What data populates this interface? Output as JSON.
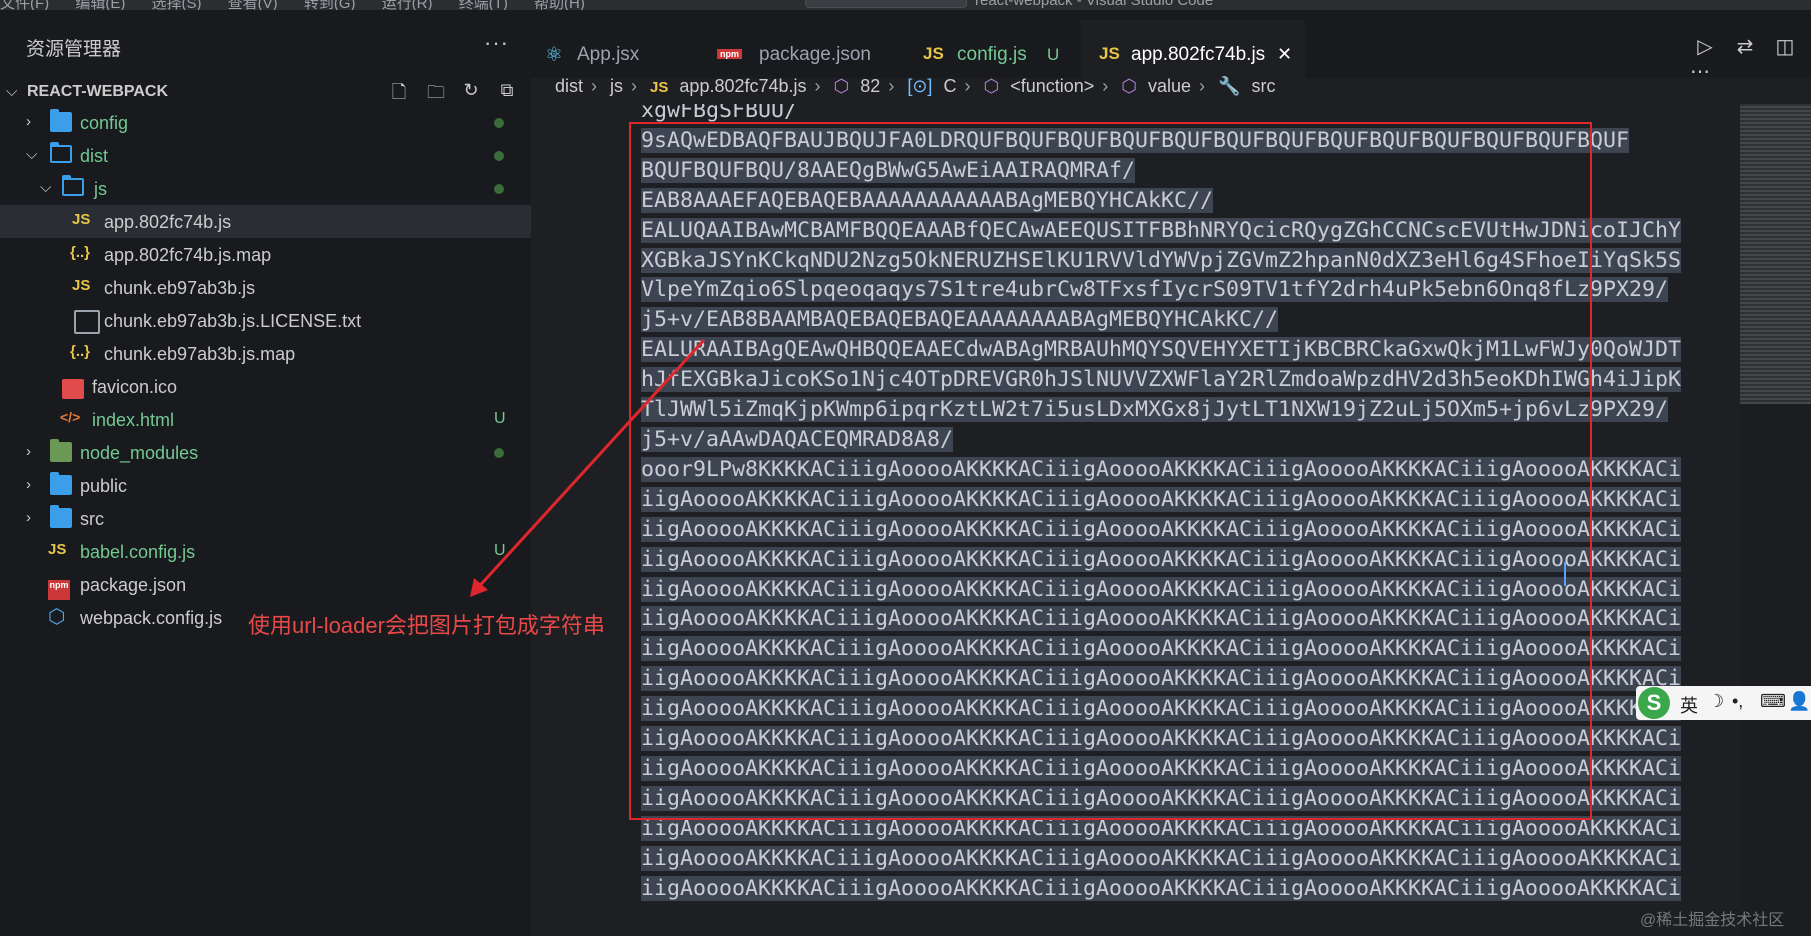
{
  "menubar": {
    "items": [
      "文件(F)",
      "编辑(E)",
      "选择(S)",
      "查看(V)",
      "转到(G)",
      "运行(R)",
      "终端(T)",
      "帮助(H)"
    ],
    "window_title": "react-webpack - Visual Studio Code"
  },
  "sidebar": {
    "title": "资源管理器",
    "more": "···",
    "root": "REACT-WEBPACK",
    "items": [
      {
        "label": "config",
        "color": "#73c991",
        "status": "dot"
      },
      {
        "label": "dist",
        "color": "#73c991",
        "status": "dot"
      },
      {
        "label": "js",
        "color": "#73c991",
        "status": "dot"
      },
      {
        "label": "app.802fc74b.js",
        "color": "#cccccc"
      },
      {
        "label": "app.802fc74b.js.map",
        "color": "#cccccc"
      },
      {
        "label": "chunk.eb97ab3b.js",
        "color": "#cccccc"
      },
      {
        "label": "chunk.eb97ab3b.js.LICENSE.txt",
        "color": "#cccccc"
      },
      {
        "label": "chunk.eb97ab3b.js.map",
        "color": "#cccccc"
      },
      {
        "label": "favicon.ico",
        "color": "#cccccc"
      },
      {
        "label": "index.html",
        "color": "#73c991",
        "status": "U"
      },
      {
        "label": "node_modules",
        "color": "#73c991",
        "status": "dot"
      },
      {
        "label": "public",
        "color": "#cccccc"
      },
      {
        "label": "src",
        "color": "#cccccc"
      },
      {
        "label": "babel.config.js",
        "color": "#73c991",
        "status": "U"
      },
      {
        "label": "package.json",
        "color": "#cccccc"
      },
      {
        "label": "webpack.config.js",
        "color": "#cccccc"
      }
    ],
    "icons": {
      "js": "JS",
      "json": "{..}",
      "html": "</>",
      "npm": "npm"
    }
  },
  "annotation": "使用url-loader会把图片打包成字符串",
  "tabs": [
    {
      "label": "App.jsx",
      "icon": "react-icon",
      "color": "#9da3ad"
    },
    {
      "label": "package.json",
      "icon": "npm-icon",
      "color": "#9da3ad"
    },
    {
      "label": "config.js",
      "icon": "js-icon",
      "color": "#73c991",
      "suffix": "U"
    },
    {
      "label": "app.802fc74b.js",
      "icon": "js-icon",
      "color": "#ffffff",
      "close": "✕"
    }
  ],
  "breadcrumb": [
    "dist",
    "js",
    "app.802fc74b.js",
    "82",
    "C",
    "<function>",
    "value",
    "src"
  ],
  "code_lines": [
    "xgwFBgSFBUU/",
    "9sAQwEDBAQFBAUJBQUJFA0LDRQUFBQUFBQUFBQUFBQUFBQUFBQUFBQUFBQUFBQUFBQUFBQUFBQUF",
    "BQUFBQUFBQU/8AAEQgBWwG5AwEiAAIRAQMRAf/",
    "EAB8AAAEFAQEBAQEBAAAAAAAAAAABAgMEBQYHCAkKC//",
    "EALUQAAIBAwMCBAMFBQQEAAABfQECAwAEEQUSITFBBhNRYQcicRQygZGhCCNCscEVUtHwJDNicoIJChY",
    "XGBkaJSYnKCkqNDU2Nzg5OkNERUZHSElKU1RVVldYWVpjZGVmZ2hpanN0dXZ3eHl6g4SFhoeIiYqSk5S",
    "VlpeYmZqio6Slpqeoqaqys7S1tre4ubrCw8TFxsfIycrS09TV1tfY2drh4uPk5ebn6Onq8fLz9PX29/",
    "j5+v/EAB8BAAMBAQEBAQEBAQEAAAAAAAABAgMEBQYHCAkKC//",
    "EALURAAIBAgQEAwQHBQQEAAECdwABAgMRBAUhMQYSQVEHYXETIjKBCBRCkaGxwQkjM1LwFWJy0QoWJDT",
    "hJfEXGBkaJicoKSo1Njc4OTpDREVGR0hJSlNUVVZXWFlaY2RlZmdoaWpzdHV2d3h5eoKDhIWGh4iJipK",
    "TlJWWl5iZmqKjpKWmp6ipqrKztLW2t7i5usLDxMXGx8jJytLT1NXW19jZ2uLj5OXm5+jp6vLz9PX29/",
    "j5+v/aAAwDAQACEQMRAD8A8/",
    "ooor9LPw8KKKKACiiigAooooAKKKKACiiigAooooAKKKKACiiigAooooAKKKKACiiigAooooAKKKKACi",
    "iigAooooAKKKKACiiigAooooAKKKKACiiigAooooAKKKKACiiigAooooAKKKKACiiigAooooAKKKKACi",
    "iigAooooAKKKKACiiigAooooAKKKKACiiigAooooAKKKKACiiigAooooAKKKKACiiigAooooAKKKKACi",
    "iigAooooAKKKKACiiigAooooAKKKKACiiigAooooAKKKKACiiigAooooAKKKKACiiigAooooAKKKKACi",
    "iigAooooAKKKKACiiigAooooAKKKKACiiigAooooAKKKKACiiigAooooAKKKKACiiigAooooAKKKKACi",
    "iigAooooAKKKKACiiigAooooAKKKKACiiigAooooAKKKKACiiigAooooAKKKKACiiigAooooAKKKKACi",
    "iigAooooAKKKKACiiigAooooAKKKKACiiigAooooAKKKKACiiigAooooAKKKKACiiigAooooAKKKKACi",
    "iigAooooAKKKKACiiigAooooAKKKKACiiigAooooAKKKKACiiigAooooAKKKKACiiigAooooAKKKKACi",
    "iigAooooAKKKKACiiigAooooAKKKKACiiigAooooAKKKKACiiigAooooAKKKKACiiigAooooAKKKKACi",
    "iigAooooAKKKKACiiigAooooAKKKKACiiigAooooAKKKKACiiigAooooAKKKKACiiigAooooAKKKKACi",
    "iigAooooAKKKKACiiigAooooAKKKKACiiigAooooAKKKKACiiigAooooAKKKKACiiigAooooAKKKKACi",
    "iigAooooAKKKKACiiigAooooAKKKKACiiigAooooAKKKKACiiigAooooAKKKKACiiigAooooAKKKKACi",
    "iigAooooAKKKKACiiigAooooAKKKKACiiigAooooAKKKKACiiigAooooAKKKKACiiigAooooAKKKKACi",
    "iigAooooAKKKKACiiigAooooAKKKKACiiigAooooAKKKKACiiigAooooAKKKKACiiigAooooAKKKKACi",
    "iigAooooAKKKKACiiigAooooAKKKKACiiigAooooAKKKKACiiigAooooAKKKKACiiigAooooAKKKKACi"
  ],
  "ime": {
    "logo": "S",
    "lang": "英",
    "icons": [
      "moon-icon",
      "punct-icon",
      "keyboard-icon",
      "user-icon"
    ]
  },
  "watermark": "@稀土掘金技术社区",
  "colors": {
    "accent": "#3b9ee8",
    "annotation": "#e0262d",
    "git_untracked": "#73c991"
  }
}
